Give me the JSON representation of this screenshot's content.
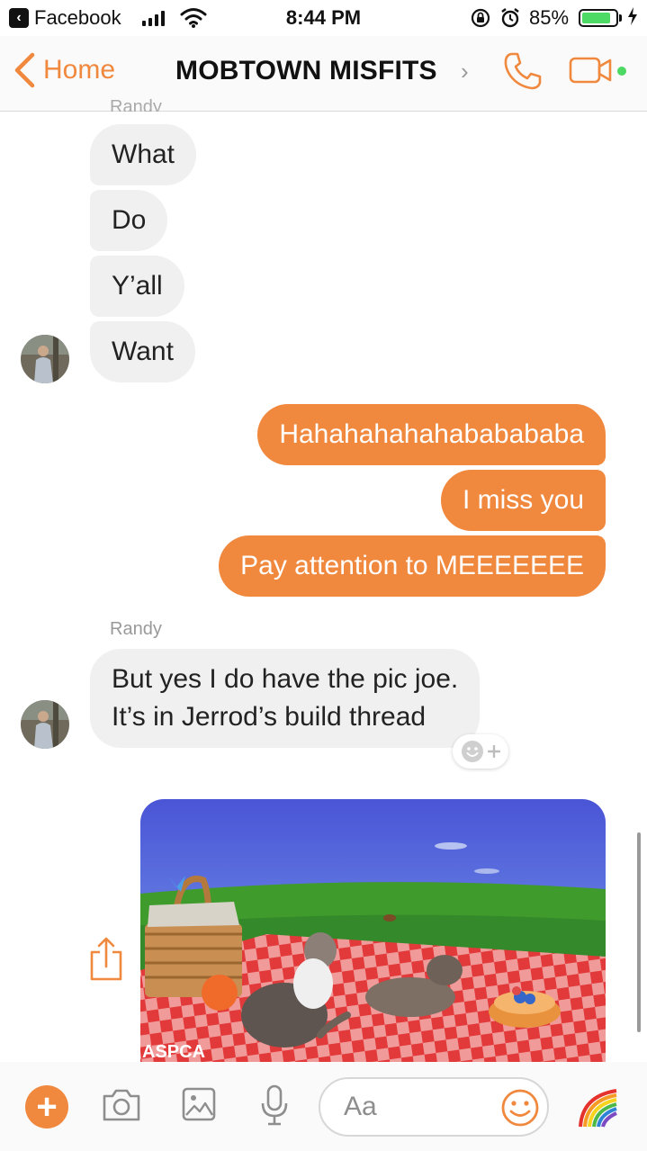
{
  "status_bar": {
    "back_app": "Facebook",
    "time": "8:44 PM",
    "battery_percent": "85%",
    "battery_level": 0.85
  },
  "header": {
    "back_label": "Home",
    "title": "MOBTOWN MISFITS",
    "chevron": "›",
    "icons": [
      "back-chevron-icon",
      "phone-icon",
      "video-camera-icon"
    ],
    "accent_color": "#f0883e"
  },
  "messages": {
    "partial_sender": "Randy",
    "incoming_group_1": [
      "What",
      "Do",
      "Y’all",
      "Want"
    ],
    "outgoing": [
      "Hahahahahahababababa",
      "I miss you",
      "Pay attention to MEEEEEEE"
    ],
    "sender_name": "Randy",
    "incoming_group_2": {
      "line1": "But yes I do have the pic joe.",
      "line2": "It’s in Jerrod’s build thread"
    },
    "image_watermark": "ASPCA"
  },
  "composer": {
    "placeholder": "Aa",
    "plus_label": "+",
    "icons": [
      "plus-icon",
      "camera-icon",
      "gallery-icon",
      "microphone-icon",
      "emoji-icon",
      "rainbow-icon"
    ]
  },
  "colors": {
    "accent": "#f0883e",
    "incoming_bubble": "#f0f0f0",
    "online_green": "#4cd964"
  }
}
